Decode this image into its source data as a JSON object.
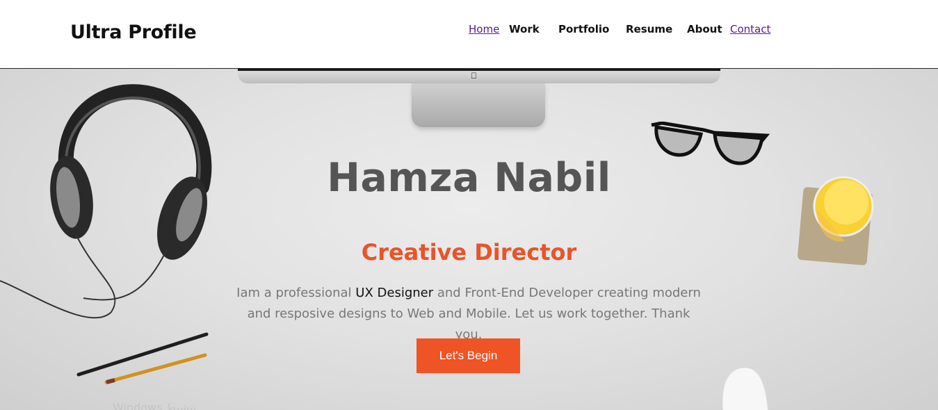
{
  "header": {
    "brand": "Ultra Profile",
    "nav": [
      {
        "label": "Home",
        "style": "link"
      },
      {
        "label": "Work",
        "style": "bold"
      },
      {
        "label": "Portfolio",
        "style": "bold"
      },
      {
        "label": "Resume",
        "style": "bold"
      },
      {
        "label": "About",
        "style": "bold"
      },
      {
        "label": "Contact",
        "style": "link"
      }
    ]
  },
  "hero": {
    "name": "Hamza Nabil",
    "role": "Creative Director",
    "description_pre": "Iam a professional ",
    "description_highlight": "UX Designer",
    "description_post": " and Front-End Developer creating modern and resposive designs to Web and Mobile. Let us work together. Thank you.",
    "cta_label": "Let's Begin",
    "watermark": "Windows تنشيط"
  },
  "colors": {
    "accent": "#ee5425",
    "title": "#555555",
    "link": "#551a8b"
  },
  "icons": [
    "apple-logo-icon"
  ]
}
